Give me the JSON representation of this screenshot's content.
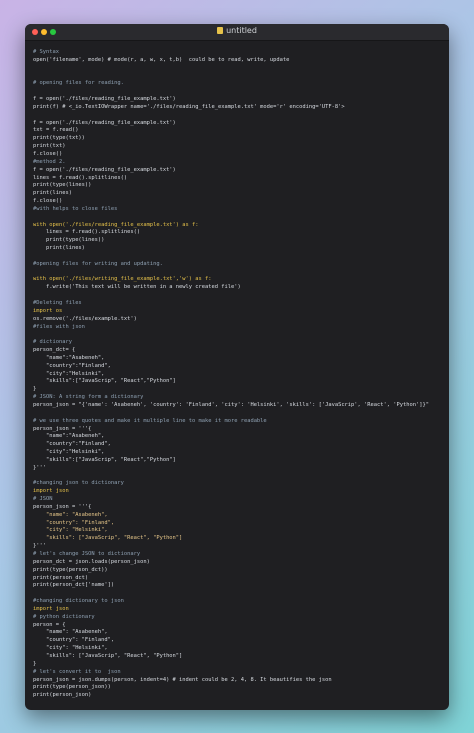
{
  "window": {
    "title": "untitled"
  },
  "code_lines": [
    {
      "t": "# Syntax",
      "c": "c"
    },
    {
      "t": "open('filename', mode) # mode(r, a, w, x, t,b)  could be to read, write, update",
      "c": "n"
    },
    {
      "t": "",
      "c": "n"
    },
    {
      "t": "",
      "c": "n"
    },
    {
      "t": "# opening files for reading.",
      "c": "c"
    },
    {
      "t": "",
      "c": "n"
    },
    {
      "t": "f = open('./files/reading_file_example.txt')",
      "c": "n"
    },
    {
      "t": "print(f) # <_io.TextIOWrapper name='./files/reading_file_example.txt' mode='r' encoding='UTF-8'>",
      "c": "n"
    },
    {
      "t": "",
      "c": "n"
    },
    {
      "t": "f = open('./files/reading_file_example.txt')",
      "c": "n"
    },
    {
      "t": "txt = f.read()",
      "c": "n"
    },
    {
      "t": "print(type(txt))",
      "c": "n"
    },
    {
      "t": "print(txt)",
      "c": "n"
    },
    {
      "t": "f.close()",
      "c": "n"
    },
    {
      "t": "#method 2.",
      "c": "c"
    },
    {
      "t": "f = open('./files/reading_file_example.txt')",
      "c": "n"
    },
    {
      "t": "lines = f.read().splitlines()",
      "c": "n"
    },
    {
      "t": "print(type(lines))",
      "c": "n"
    },
    {
      "t": "print(lines)",
      "c": "n"
    },
    {
      "t": "f.close()",
      "c": "n"
    },
    {
      "t": "#with helps to close files",
      "c": "c"
    },
    {
      "t": "",
      "c": "n"
    },
    {
      "t": "with open('./files/reading_file_example.txt') as f:",
      "c": "k"
    },
    {
      "t": "    lines = f.read().splitlines()",
      "c": "n"
    },
    {
      "t": "    print(type(lines))",
      "c": "n"
    },
    {
      "t": "    print(lines)",
      "c": "n"
    },
    {
      "t": "",
      "c": "n"
    },
    {
      "t": "#opening files for writing and updating.",
      "c": "c"
    },
    {
      "t": "",
      "c": "n"
    },
    {
      "t": "with open('./files/writing_file_example.txt','w') as f:",
      "c": "k"
    },
    {
      "t": "    f.write('This text will be written in a newly created file')",
      "c": "n"
    },
    {
      "t": "",
      "c": "n"
    },
    {
      "t": "#Deleting files",
      "c": "c"
    },
    {
      "t": "import os",
      "c": "k"
    },
    {
      "t": "os.remove('./files/example.txt')",
      "c": "n"
    },
    {
      "t": "#files with json",
      "c": "c"
    },
    {
      "t": "",
      "c": "n"
    },
    {
      "t": "# dictionary",
      "c": "c"
    },
    {
      "t": "person_dct= {",
      "c": "n"
    },
    {
      "t": "    \"name\":\"Asabeneh\",",
      "c": "n"
    },
    {
      "t": "    \"country\":\"Finland\",",
      "c": "n"
    },
    {
      "t": "    \"city\":\"Helsinki\",",
      "c": "n"
    },
    {
      "t": "    \"skills\":[\"JavaScrip\", \"React\",\"Python\"]",
      "c": "n"
    },
    {
      "t": "}",
      "c": "n"
    },
    {
      "t": "# JSON: A string form a dictionary",
      "c": "c"
    },
    {
      "t": "person_json = \"{'name': 'Asabeneh', 'country': 'Finland', 'city': 'Helsinki', 'skills': ['JavaScrip', 'React', 'Python']}\"",
      "c": "n"
    },
    {
      "t": "",
      "c": "n"
    },
    {
      "t": "# we use three quotes and make it multiple line to make it more readable",
      "c": "c"
    },
    {
      "t": "person_json = '''{",
      "c": "n"
    },
    {
      "t": "    \"name\":\"Asabeneh\",",
      "c": "n"
    },
    {
      "t": "    \"country\":\"Finland\",",
      "c": "n"
    },
    {
      "t": "    \"city\":\"Helsinki\",",
      "c": "n"
    },
    {
      "t": "    \"skills\":[\"JavaScrip\", \"React\",\"Python\"]",
      "c": "n"
    },
    {
      "t": "}'''",
      "c": "n"
    },
    {
      "t": "",
      "c": "n"
    },
    {
      "t": "#changing json to dictionary",
      "c": "c"
    },
    {
      "t": "import json",
      "c": "k"
    },
    {
      "t": "# JSON",
      "c": "c"
    },
    {
      "t": "person_json = '''{",
      "c": "n"
    },
    {
      "t": "    \"name\": \"Asabeneh\",",
      "c": "s"
    },
    {
      "t": "    \"country\": \"Finland\",",
      "c": "s"
    },
    {
      "t": "    \"city\": \"Helsinki\",",
      "c": "s"
    },
    {
      "t": "    \"skills\": [\"JavaScrip\", \"React\", \"Python\"]",
      "c": "s"
    },
    {
      "t": "}'''",
      "c": "n"
    },
    {
      "t": "# let's change JSON to dictionary",
      "c": "c"
    },
    {
      "t": "person_dct = json.loads(person_json)",
      "c": "n"
    },
    {
      "t": "print(type(person_dct))",
      "c": "n"
    },
    {
      "t": "print(person_dct)",
      "c": "n"
    },
    {
      "t": "print(person_dct['name'])",
      "c": "n"
    },
    {
      "t": "",
      "c": "n"
    },
    {
      "t": "#changing dictionary to json",
      "c": "c"
    },
    {
      "t": "import json",
      "c": "k"
    },
    {
      "t": "# python dictionary",
      "c": "c"
    },
    {
      "t": "person = {",
      "c": "n"
    },
    {
      "t": "    \"name\": \"Asabeneh\",",
      "c": "n"
    },
    {
      "t": "    \"country\": \"Finland\",",
      "c": "n"
    },
    {
      "t": "    \"city\": \"Helsinki\",",
      "c": "n"
    },
    {
      "t": "    \"skills\": [\"JavaScrip\", \"React\", \"Python\"]",
      "c": "n"
    },
    {
      "t": "}",
      "c": "n"
    },
    {
      "t": "# let's convert it to  json",
      "c": "c"
    },
    {
      "t": "person_json = json.dumps(person, indent=4) # indent could be 2, 4, 8. It beautifies the json",
      "c": "n"
    },
    {
      "t": "print(type(person_json))",
      "c": "n"
    },
    {
      "t": "print(person_json)",
      "c": "n"
    }
  ],
  "colors": {
    "window_bg": "#1f1f22",
    "comment": "#8fa1b3",
    "string": "#e9c98b",
    "keyword": "#e6c24a",
    "text": "#d9dde3"
  },
  "icons": {
    "close": "red-dot",
    "minimize": "yellow-dot",
    "maximize": "green-dot",
    "file": "file-icon"
  }
}
